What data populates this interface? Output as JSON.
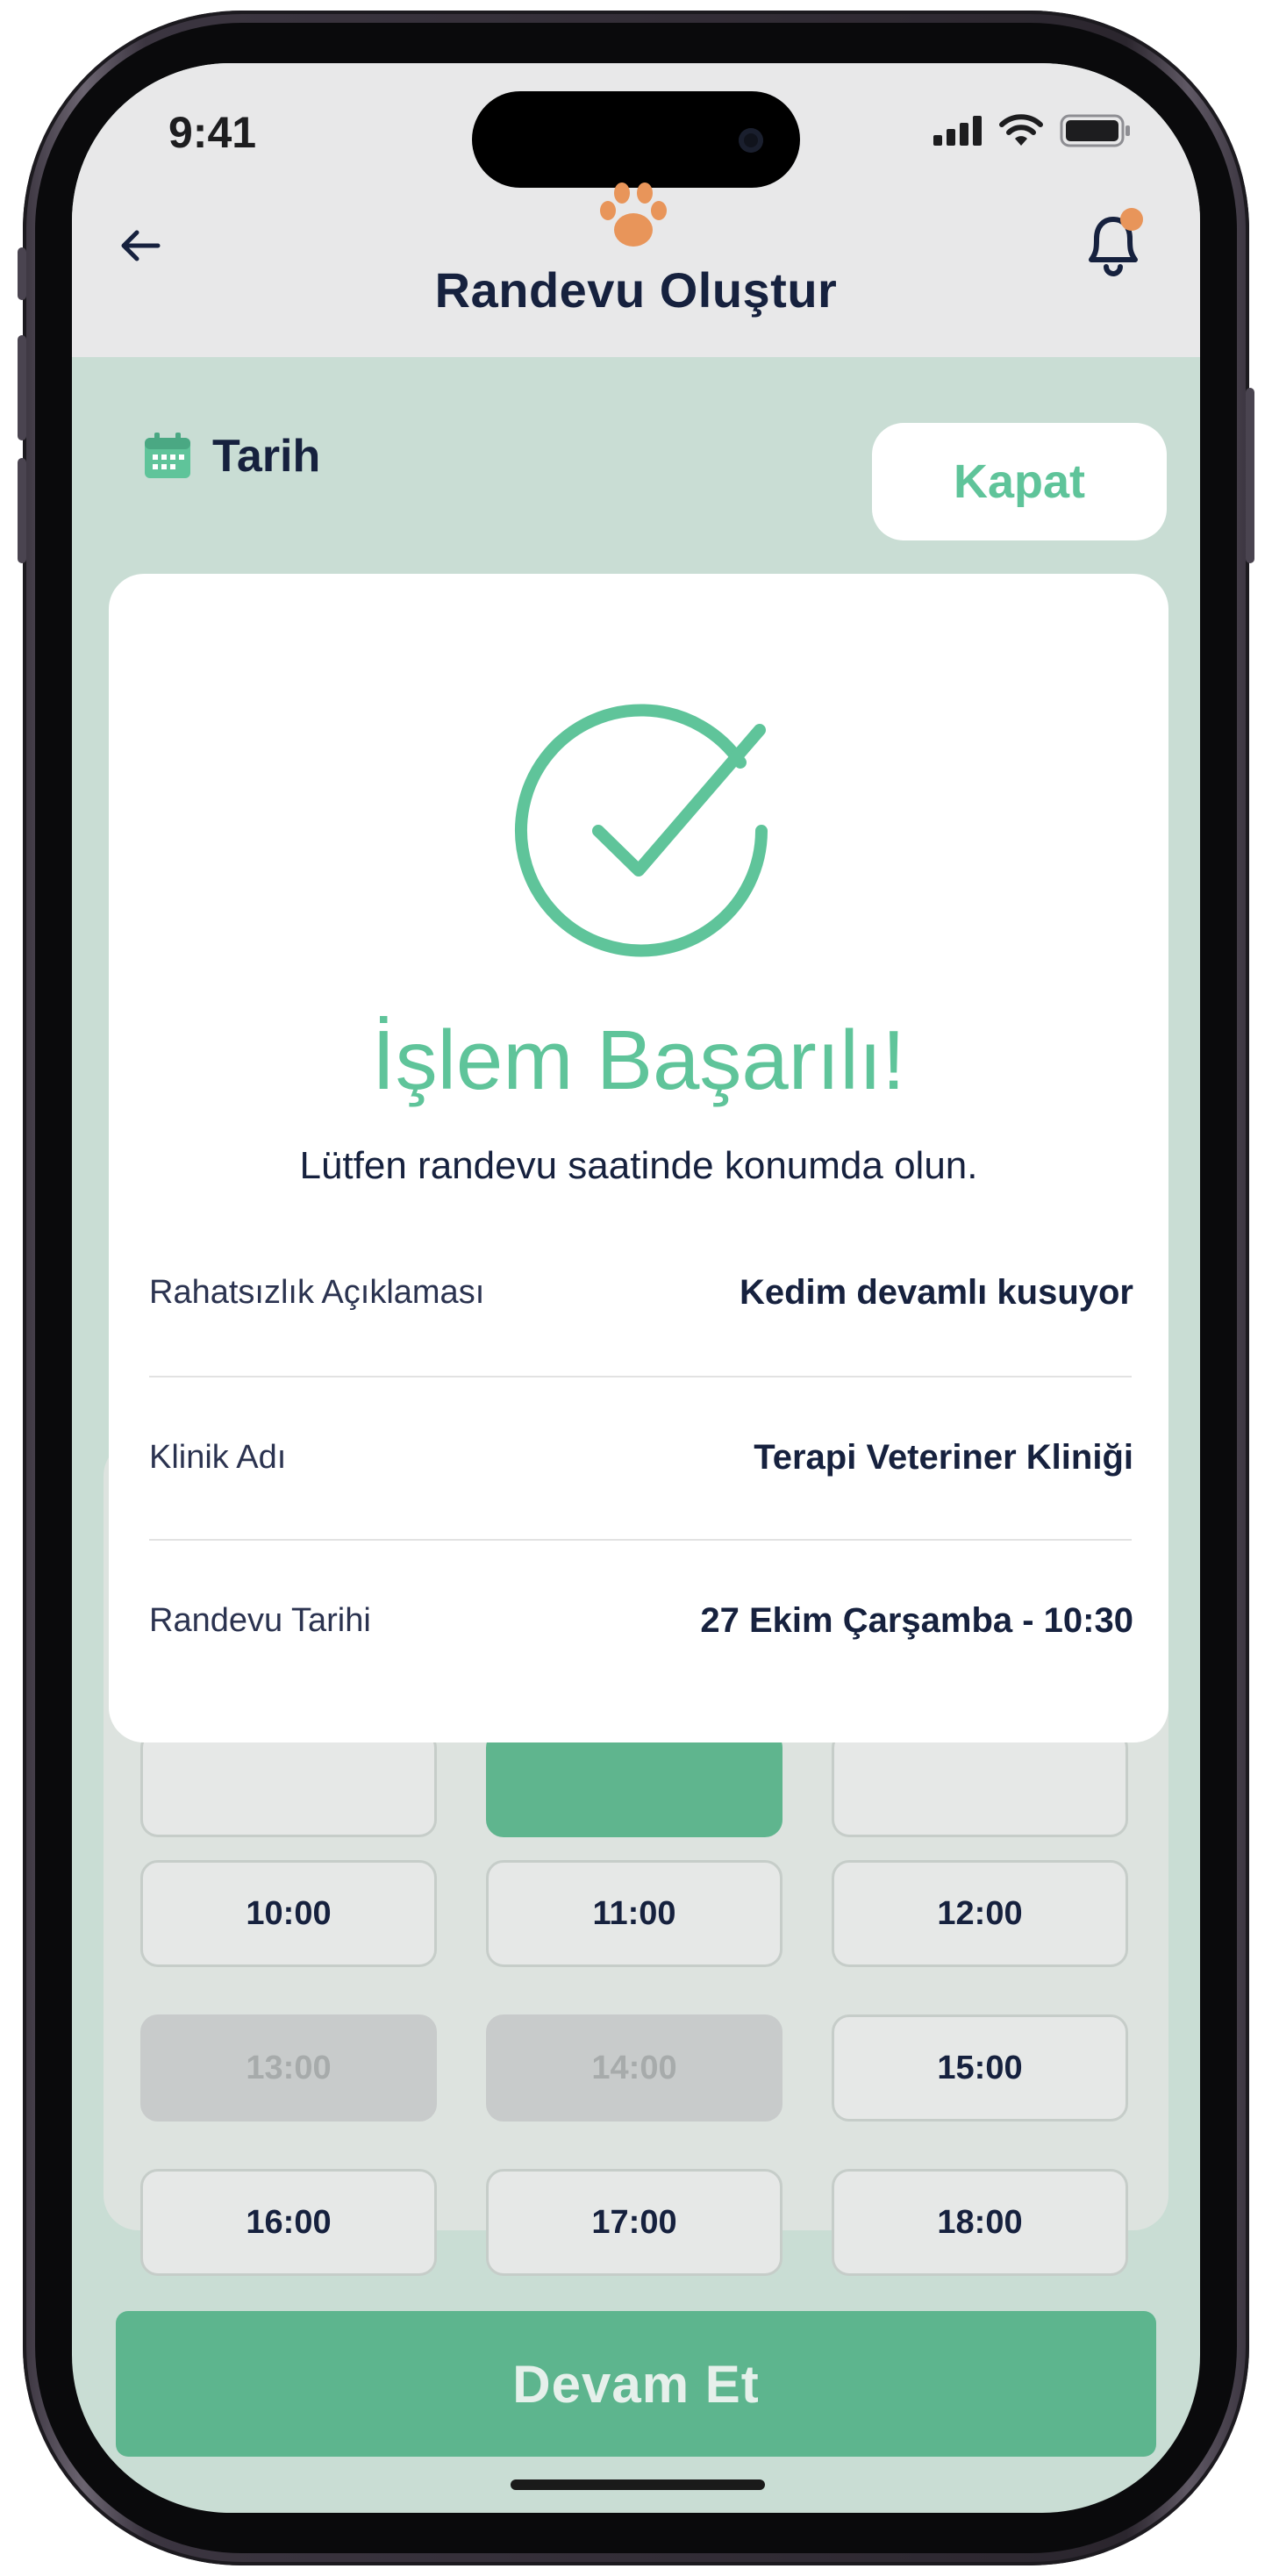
{
  "status_bar": {
    "time": "9:41"
  },
  "header": {
    "title": "Randevu Oluştur"
  },
  "date_section": {
    "label": "Tarih",
    "close_label": "Kapat"
  },
  "modal": {
    "title": "İşlem Başarılı!",
    "subtitle": "Lütfen randevu saatinde konumda olun.",
    "rows": [
      {
        "label": "Rahatsızlık Açıklaması",
        "value": "Kedim devamlı kusuyor"
      },
      {
        "label": "Klinik Adı",
        "value": "Terapi Veteriner Kliniği"
      },
      {
        "label": "Randevu Tarihi",
        "value": "27 Ekim Çarşamba - 10:30"
      }
    ]
  },
  "time_slots": [
    {
      "label": "10:00",
      "state": "available"
    },
    {
      "label": "11:00",
      "state": "available"
    },
    {
      "label": "12:00",
      "state": "available"
    },
    {
      "label": "13:00",
      "state": "disabled"
    },
    {
      "label": "14:00",
      "state": "disabled"
    },
    {
      "label": "15:00",
      "state": "available"
    },
    {
      "label": "16:00",
      "state": "available"
    },
    {
      "label": "17:00",
      "state": "available"
    },
    {
      "label": "18:00",
      "state": "available"
    }
  ],
  "continue_label": "Devam Et",
  "colors": {
    "accent": "#5fc49a",
    "primary_button": "#5db58e",
    "navy": "#16213e",
    "paw": "#e8955a",
    "notification_dot": "#e8955a"
  }
}
